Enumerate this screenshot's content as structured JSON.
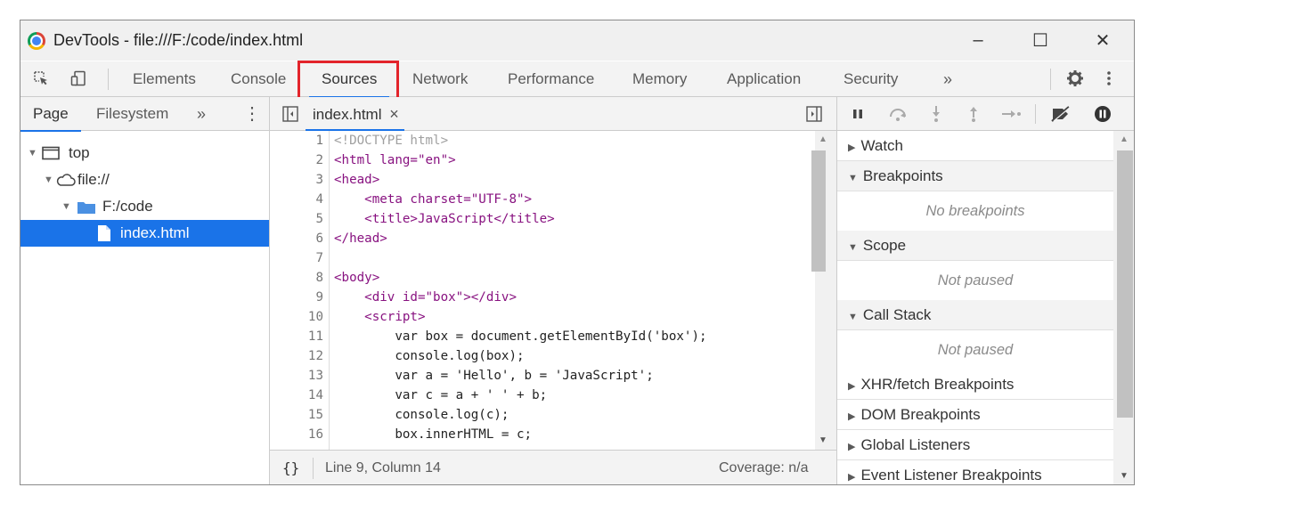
{
  "window": {
    "title": "DevTools - file:///F:/code/index.html",
    "minimize": "–",
    "maximize": "☐",
    "close": "✕"
  },
  "tabs": [
    "Elements",
    "Console",
    "Sources",
    "Network",
    "Performance",
    "Memory",
    "Application",
    "Security"
  ],
  "tabs_more": "»",
  "active_tab": "Sources",
  "navigator": {
    "tabs": [
      "Page",
      "Filesystem"
    ],
    "more": "»",
    "menu": "⋮",
    "tree": [
      "top",
      "file://",
      "F:/code",
      "index.html"
    ]
  },
  "editor": {
    "file_tab": "index.html",
    "close": "×",
    "lines": [
      "<!DOCTYPE html>",
      "<html lang=\"en\">",
      "<head>",
      "    <meta charset=\"UTF-8\">",
      "    <title>JavaScript</title>",
      "</head>",
      "",
      "<body>",
      "    <div id=\"box\"></div>",
      "    <script>",
      "        var box = document.getElementById('box');",
      "        console.log(box);",
      "        var a = 'Hello', b = 'JavaScript';",
      "        var c = a + ' ' + b;",
      "        console.log(c);",
      "        box.innerHTML = c;"
    ],
    "status_braces": "{}",
    "status_position": "Line 9, Column 14",
    "status_coverage": "Coverage: n/a"
  },
  "debugger": {
    "sections": [
      {
        "label": "Watch",
        "open": false
      },
      {
        "label": "Breakpoints",
        "open": true,
        "content": "No breakpoints"
      },
      {
        "label": "Scope",
        "open": true,
        "content": "Not paused"
      },
      {
        "label": "Call Stack",
        "open": true,
        "content": "Not paused"
      },
      {
        "label": "XHR/fetch Breakpoints",
        "open": false
      },
      {
        "label": "DOM Breakpoints",
        "open": false
      },
      {
        "label": "Global Listeners",
        "open": false
      },
      {
        "label": "Event Listener Breakpoints",
        "open": false
      }
    ]
  },
  "colors": {
    "accent": "#1a73e8",
    "highlight_box": "#e3242b",
    "selection": "#1a73e8"
  }
}
